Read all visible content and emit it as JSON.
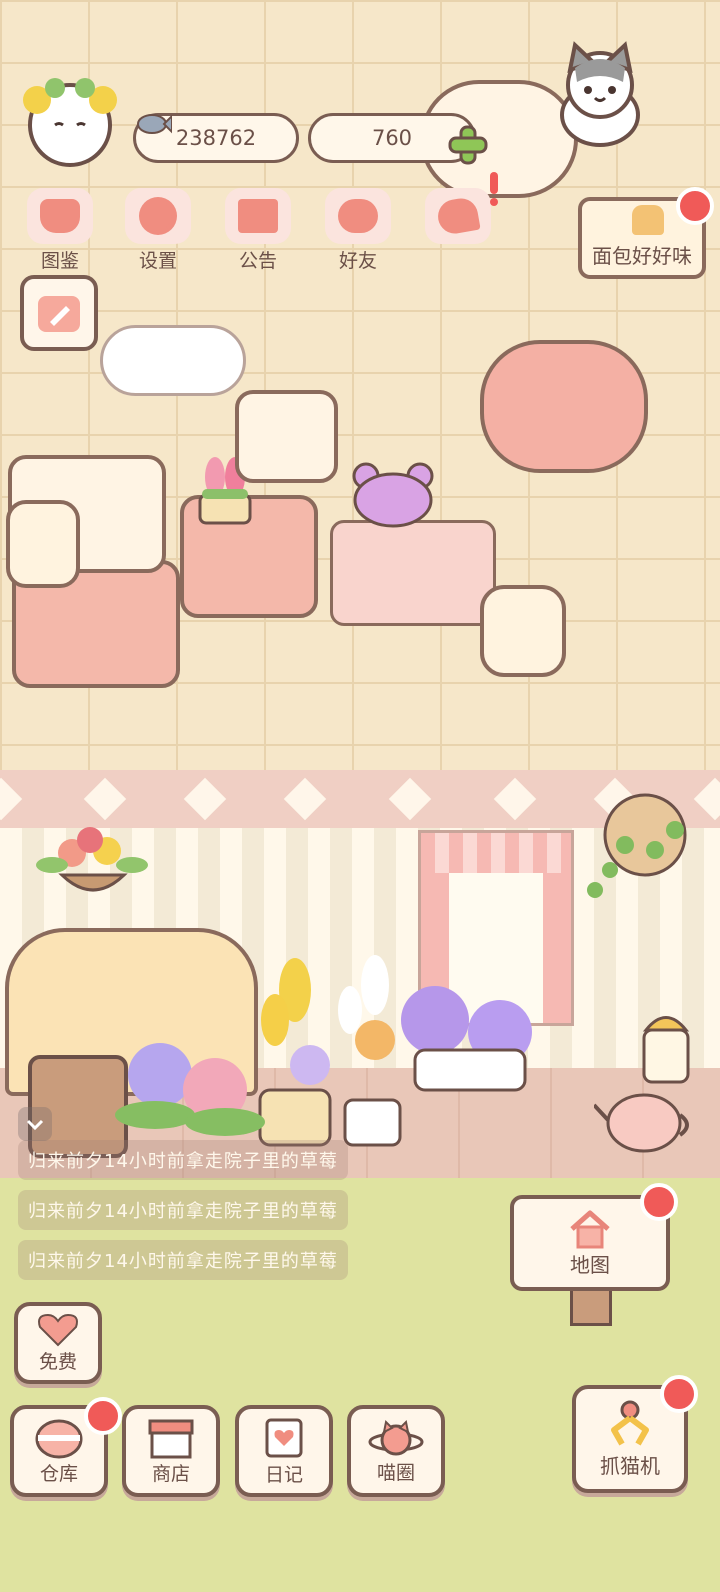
{
  "currency": {
    "fish": "238762",
    "gems": "760"
  },
  "top_menu": [
    {
      "label": "图鉴"
    },
    {
      "label": "设置"
    },
    {
      "label": "公告"
    },
    {
      "label": "好友"
    }
  ],
  "sign": {
    "label": "面包好好味"
  },
  "notices": [
    "归来前夕14小时前拿走院子里的草莓",
    "归来前夕14小时前拿走院子里的草莓",
    "归来前夕14小时前拿走院子里的草莓"
  ],
  "map_button": {
    "label": "地图"
  },
  "free_button": {
    "label": "免费"
  },
  "bottom_bar": [
    {
      "label": "仓库"
    },
    {
      "label": "商店"
    },
    {
      "label": "日记"
    },
    {
      "label": "喵圈"
    }
  ],
  "claw_button": {
    "label": "抓猫机"
  },
  "colors": {
    "accent_pink": "#f08d80",
    "notification_red": "#f05a58",
    "outline_brown": "#7a5d52"
  }
}
